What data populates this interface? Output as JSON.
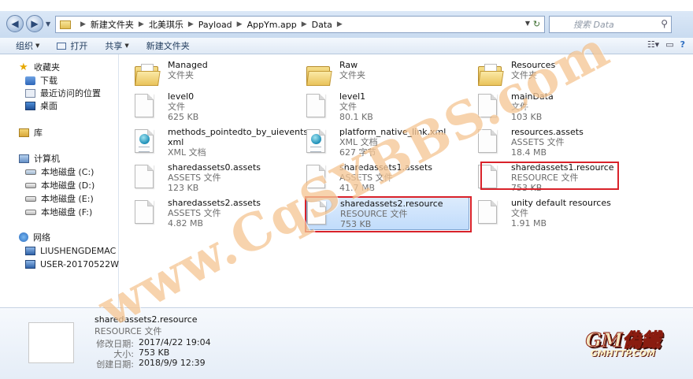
{
  "address": {
    "breadcrumbs": [
      "新建文件夹",
      "北美琪乐",
      "Payload",
      "AppYm.app",
      "Data"
    ],
    "search_placeholder": "搜索 Data"
  },
  "toolbar": {
    "organize": "组织",
    "open": "打开",
    "share": "共享",
    "new_folder": "新建文件夹"
  },
  "nav": {
    "favorites": {
      "title": "收藏夹",
      "items": [
        "下载",
        "最近访问的位置",
        "桌面"
      ]
    },
    "library": "库",
    "computer": {
      "title": "计算机",
      "drives": [
        "本地磁盘 (C:)",
        "本地磁盘 (D:)",
        "本地磁盘 (E:)",
        "本地磁盘 (F:)"
      ]
    },
    "network": {
      "title": "网络",
      "hosts": [
        "LIUSHENGDEMAC",
        "USER-20170522WW"
      ]
    }
  },
  "files": [
    {
      "name": "Managed",
      "type": "文件夹",
      "size": "",
      "icon": "folder-icon"
    },
    {
      "name": "Raw",
      "type": "文件夹",
      "size": "",
      "icon": "folder-icon"
    },
    {
      "name": "Resources",
      "type": "文件夹",
      "size": "",
      "icon": "folder-icon"
    },
    {
      "name": "level0",
      "type": "文件",
      "size": "625 KB",
      "icon": "file-icon"
    },
    {
      "name": "level1",
      "type": "文件",
      "size": "80.1 KB",
      "icon": "file-icon"
    },
    {
      "name": "mainData",
      "type": "文件",
      "size": "103 KB",
      "icon": "file-icon"
    },
    {
      "name": "methods_pointedto_by_uievents.",
      "name2": "xml",
      "type": "XML 文档",
      "size": "",
      "icon": "xml-icon"
    },
    {
      "name": "platform_native_link.xml",
      "type": "XML 文档",
      "size": "627 字节",
      "icon": "xml-icon"
    },
    {
      "name": "resources.assets",
      "type": "ASSETS 文件",
      "size": "18.4 MB",
      "icon": "file-icon"
    },
    {
      "name": "sharedassets0.assets",
      "type": "ASSETS 文件",
      "size": "123 KB",
      "icon": "file-icon"
    },
    {
      "name": "sharedassets1.assets",
      "type": "ASSETS 文件",
      "size": "41.7 MB",
      "icon": "file-icon"
    },
    {
      "name": "sharedassets1.resource",
      "type": "RESOURCE 文件",
      "size": "753 KB",
      "icon": "file-icon"
    },
    {
      "name": "sharedassets2.assets",
      "type": "ASSETS 文件",
      "size": "4.82 MB",
      "icon": "file-icon"
    },
    {
      "name": "sharedassets2.resource",
      "type": "RESOURCE 文件",
      "size": "753 KB",
      "icon": "file-icon"
    },
    {
      "name": "unity default resources",
      "type": "文件",
      "size": "1.91 MB",
      "icon": "file-icon"
    }
  ],
  "details": {
    "name": "sharedassets2.resource",
    "type": "RESOURCE 文件",
    "modified_label": "修改日期:",
    "modified": "2017/4/22 19:04",
    "size_label": "大小:",
    "size": "753 KB",
    "created_label": "创建日期:",
    "created": "2018/9/9 12:39"
  },
  "watermark": "www.CqSYBBS.com",
  "logo": {
    "main": "GM偽鐵",
    "sub": "GMHTTP.COM"
  },
  "colors": {
    "highlight_box": "#d9222a",
    "selection": "#c1dcfb",
    "accent": "#2f6fc2"
  }
}
